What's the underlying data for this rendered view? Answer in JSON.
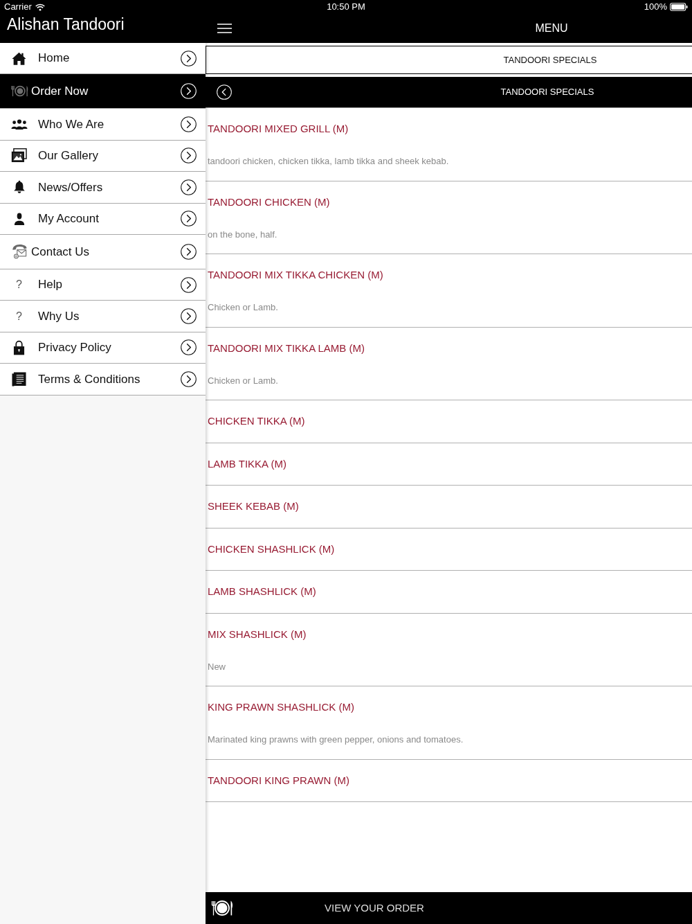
{
  "status_bar": {
    "carrier": "Carrier",
    "time": "10:50 PM",
    "battery": "100%"
  },
  "sidebar": {
    "title": "Alishan Tandoori",
    "items": [
      {
        "label": "Home",
        "selected": false
      },
      {
        "label": "Order Now",
        "selected": true
      },
      {
        "label": "Who We Are",
        "selected": false
      },
      {
        "label": "Our Gallery",
        "selected": false
      },
      {
        "label": "News/Offers",
        "selected": false
      },
      {
        "label": "My Account",
        "selected": false
      },
      {
        "label": "Contact Us",
        "selected": false
      },
      {
        "label": "Help",
        "glyph": "?",
        "selected": false
      },
      {
        "label": "Why Us",
        "glyph": "?",
        "selected": false
      },
      {
        "label": "Privacy Policy",
        "selected": false
      },
      {
        "label": "Terms & Conditions",
        "selected": false
      }
    ]
  },
  "header": {
    "title": "MENU"
  },
  "category": {
    "button": "TANDOORI SPECIALS",
    "title": "TANDOORI SPECIALS"
  },
  "menu_items": [
    {
      "name": "TANDOORI MIXED GRILL (M)",
      "description": "tandoori chicken, chicken tikka, lamb tikka and sheek kebab."
    },
    {
      "name": "TANDOORI CHICKEN (M)",
      "description": "on the bone, half."
    },
    {
      "name": "TANDOORI MIX TIKKA CHICKEN (M)",
      "description": "Chicken or Lamb."
    },
    {
      "name": "TANDOORI MIX TIKKA LAMB (M)",
      "description": "Chicken or Lamb."
    },
    {
      "name": "CHICKEN TIKKA (M)"
    },
    {
      "name": "LAMB TIKKA (M)"
    },
    {
      "name": "SHEEK KEBAB (M)"
    },
    {
      "name": "CHICKEN SHASHLICK (M)"
    },
    {
      "name": "LAMB SHASHLICK (M)"
    },
    {
      "name": "MIX SHASHLICK (M)",
      "description": "New"
    },
    {
      "name": "KING PRAWN SHASHLICK (M)",
      "description": "Marinated king prawns with green pepper, onions and tomatoes."
    },
    {
      "name": "TANDOORI KING PRAWN (M)"
    }
  ],
  "order_bar": {
    "label": "VIEW YOUR ORDER"
  }
}
